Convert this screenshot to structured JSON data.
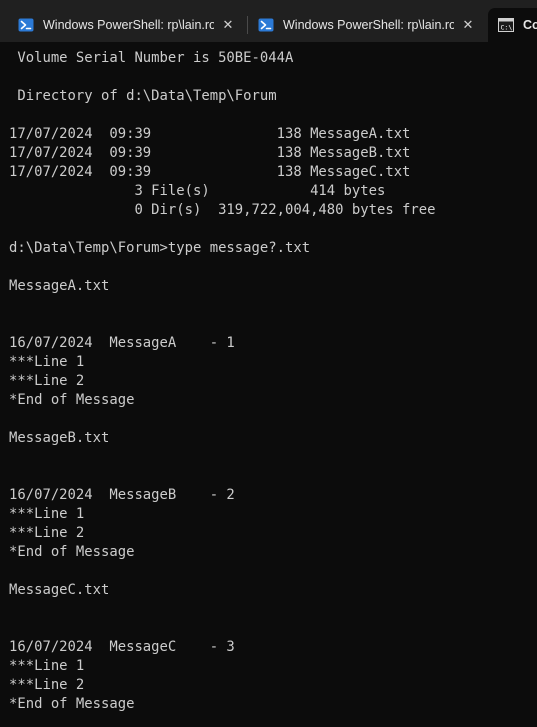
{
  "tabs": [
    {
      "title": "Windows PowerShell: rp\\lain.ro",
      "icon": "powershell-icon",
      "active": false,
      "close_glyph": "✕"
    },
    {
      "title": "Windows PowerShell: rp\\lain.ro",
      "icon": "powershell-icon",
      "active": false,
      "close_glyph": "✕"
    },
    {
      "title": "Co",
      "icon": "command-prompt-icon",
      "active": true,
      "close_glyph": ""
    }
  ],
  "colors": {
    "tabbar_background": "#202020",
    "terminal_background": "#0c0c0c",
    "terminal_text": "#cccccc",
    "powershell_icon_blue": "#2c7ad6"
  },
  "terminal": {
    "lines": [
      " Volume Serial Number is 50BE-044A",
      "",
      " Directory of d:\\Data\\Temp\\Forum",
      "",
      "17/07/2024  09:39               138 MessageA.txt",
      "17/07/2024  09:39               138 MessageB.txt",
      "17/07/2024  09:39               138 MessageC.txt",
      "               3 File(s)            414 bytes",
      "               0 Dir(s)  319,722,004,480 bytes free",
      "",
      "d:\\Data\\Temp\\Forum>type message?.txt",
      "",
      "MessageA.txt",
      "",
      "",
      "16/07/2024  MessageA    - 1",
      "***Line 1",
      "***Line 2",
      "*End of Message",
      "",
      "MessageB.txt",
      "",
      "",
      "16/07/2024  MessageB    - 2",
      "***Line 1",
      "***Line 2",
      "*End of Message",
      "",
      "MessageC.txt",
      "",
      "",
      "16/07/2024  MessageC    - 3",
      "***Line 1",
      "***Line 2",
      "*End of Message"
    ]
  }
}
